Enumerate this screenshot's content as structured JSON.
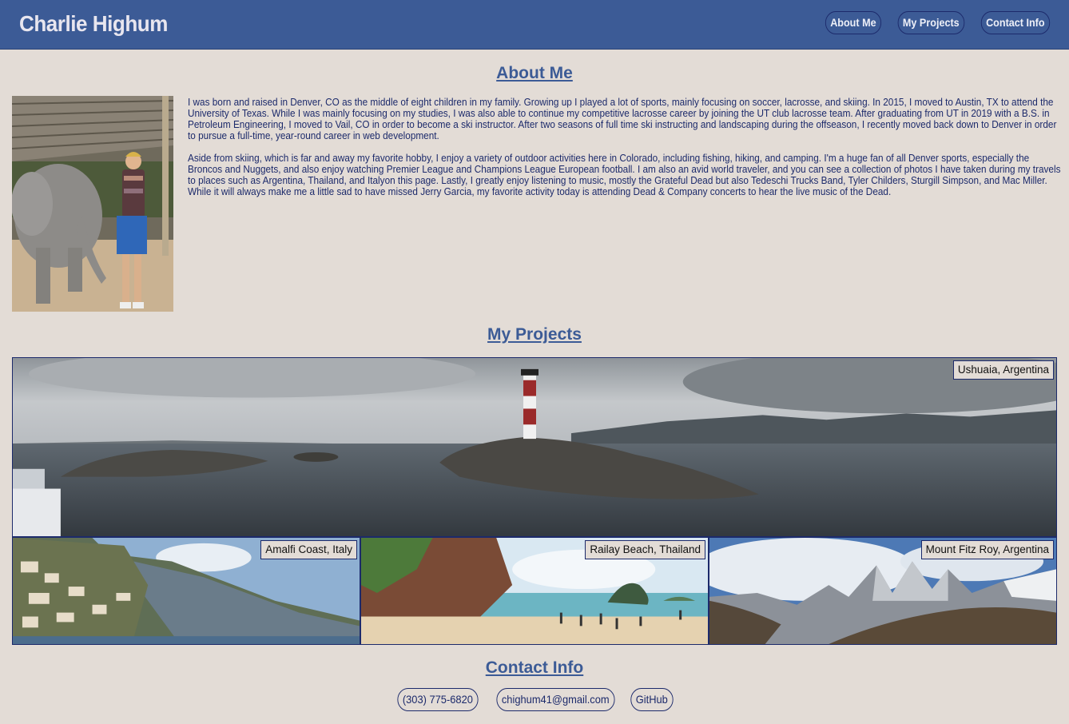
{
  "header": {
    "title": "Charlie Highum",
    "nav": [
      {
        "label": "About Me"
      },
      {
        "label": "My Projects"
      },
      {
        "label": "Contact Info"
      }
    ]
  },
  "about": {
    "heading": "About Me",
    "paragraphs": [
      "I was born and raised in Denver, CO as the middle of eight children in my family. Growing up I played a lot of sports, mainly focusing on soccer, lacrosse, and skiing. In 2015, I moved to Austin, TX to attend the University of Texas. While I was mainly focusing on my studies, I was also able to continue my competitive lacrosse career by joining the UT club lacrosse team. After graduating from UT in 2019 with a B.S. in Petroleum Engineering, I moved to Vail, CO in order to become a ski instructor. After two seasons of full time ski instructing and landscaping during the offseason, I recently moved back down to Denver in order to pursue a full-time, year-round career in web development.",
      "Aside from skiing, which is far and away my favorite hobby, I enjoy a variety of outdoor activities here in Colorado, including fishing, hiking, and camping. I'm a huge fan of all Denver sports, especially the Broncos and Nuggets, and also enjoy watching Premier League and Champions League European football. I am also an avid world traveler, and you can see a collection of photos I have taken during my travels to places such as Argentina, Thailand, and Italyon this page. Lastly, I greatly enjoy listening to music, mostly the Grateful Dead but also Tedeschi Trucks Band, Tyler Childers, Sturgill Simpson, and Mac Miller. While it will always make me a little sad to have missed Jerry Garcia, my favorite activity today is attending Dead & Company concerts to hear the live music of the Dead."
    ]
  },
  "projects": {
    "heading": "My Projects",
    "tiles": [
      {
        "caption": "Ushuaia, Argentina"
      },
      {
        "caption": "Amalfi Coast, Italy"
      },
      {
        "caption": "Railay Beach, Thailand"
      },
      {
        "caption": "Mount Fitz Roy, Argentina"
      }
    ]
  },
  "contact": {
    "heading": "Contact Info",
    "links": [
      {
        "label": "(303) 775-6820"
      },
      {
        "label": "chighum41@gmail.com"
      },
      {
        "label": "GitHub"
      }
    ]
  },
  "colors": {
    "header_bg": "#3c5b96",
    "page_bg": "#e3dcd6",
    "text": "#1c2a6b"
  }
}
